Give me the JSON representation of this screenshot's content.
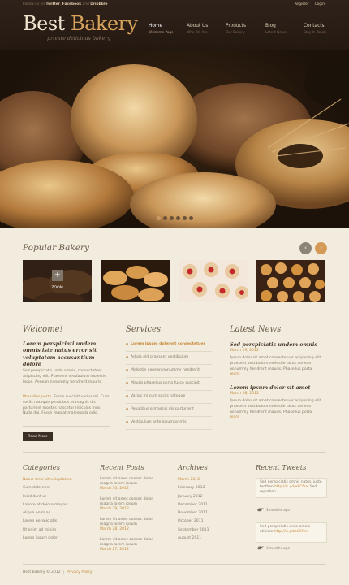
{
  "topbar": {
    "follow_prefix": "Follow us on",
    "twitter": "Twitter",
    "facebook": "Facebook",
    "and": "and",
    "dribbble": "Dribbble",
    "register": "Register",
    "login": "Login"
  },
  "logo": {
    "best": "Best",
    "bakery": "Bakery",
    "tagline": "private delicious bakery"
  },
  "nav": [
    {
      "label": "Home",
      "sub": "Welcome Page"
    },
    {
      "label": "About Us",
      "sub": "Who We Are"
    },
    {
      "label": "Products",
      "sub": "Our Bakery"
    },
    {
      "label": "Blog",
      "sub": "Latest News"
    },
    {
      "label": "Contacts",
      "sub": "Stay In Touch"
    }
  ],
  "colors": {
    "accent": "#c78a3c",
    "header_bg": "#2a1e15",
    "page_bg": "#f1ecde"
  },
  "popular": {
    "title": "Popular Bakery",
    "prev_icon": "‹",
    "next_icon": "›",
    "zoom_plus": "+",
    "zoom_label": "ZOOM"
  },
  "welcome": {
    "title": "Welcome!",
    "intro": "Lorem perspiciati undem omnis iste natus error sit voluptatem accusantium dolore",
    "body1": "Sed perspiciatis unde omnis, consectetuer adipiscing elit. Praesent vestibulum molestie lacus. Aenean nonummy hendrerit mauris.",
    "link": "Phasellus porta.",
    "body2": "Fusce suscipit varius mi. Cum sociis natoque penatibus et magnis dis parturient montes nascetur ridiculus mus. Nulla dui. Fusce feugiat malesuada odio.",
    "read_more": "Read More"
  },
  "services": {
    "title": "Services",
    "items": [
      "Lorem ipsum dolemet consectetuer",
      "Adipis elit praesent vestibulum",
      "Molestie aenean nonummy hendrerit",
      "Mauris phasellus porta fusce suscipit",
      "Varius mi cum sociis natoque",
      "Penatibus etmagnis dis parturient",
      "Vestibulum ante ipsum primis"
    ]
  },
  "news": {
    "title": "Latest News",
    "items": [
      {
        "title": "Sed perspiciatis undem omnis",
        "date": "March 29, 2012",
        "body": "Ipsum dolor sit amet consectetuer adipiscing elit praesent vestibulum molestie lacus aenean nonummy hendrerit mauris. Phasellus porta.",
        "more": "more"
      },
      {
        "title": "Lorem ipsum dolor sit amet",
        "date": "March 28, 2012",
        "body": "Ipsum dolor sit amet consectetuer adipiscing elit praesent vestibulum molestie lacus aenean nonummy hendrerit mauris. Phasellus porta.",
        "more": "more"
      }
    ]
  },
  "categories": {
    "title": "Categories",
    "items": [
      "Natus error sit voluptatem",
      "Cum doloremd",
      "Incididunt ut",
      "Labore et dolore magne",
      "Aliqua enim ac",
      "Lorem perspiciatis",
      "Ut enim ad minim",
      "Lorem ipsum dolor"
    ]
  },
  "recent_posts": {
    "title": "Recent Posts",
    "items": [
      {
        "text": "Lorem sit amet consec dolor magna lorem ipsum",
        "date": "March 30, 2012"
      },
      {
        "text": "Lorem sit amet consec dolor magna lorem ipsum",
        "date": "March 29, 2012"
      },
      {
        "text": "Lorem sit amet consec dolor magna lorem ipsum",
        "date": "March 28, 2012"
      },
      {
        "text": "Lorem sit amet consec dolor magna lorem ipsum",
        "date": "March 27, 2012"
      }
    ]
  },
  "archives": {
    "title": "Archives",
    "items": [
      "March 2012",
      "February 2012",
      "January 2012",
      "December 2011",
      "November 2011",
      "October 2011",
      "September 2011",
      "August 2011"
    ]
  },
  "tweets": {
    "title": "Recent Tweets",
    "items": [
      {
        "text": "Sed perspiciatis omnis natus, iusto tecthen",
        "link": "http://is.gd/e8Cfenl",
        "text2": "Sed reprehen",
        "ago": "3 months ago"
      },
      {
        "text": "Sed perspiciatis unde omnis otionan",
        "link": "http://is.gd/e8Cfenl",
        "text2": "",
        "ago": "3 months ago"
      }
    ]
  },
  "footer": {
    "copyright": "Best Bakery © 2012",
    "privacy": "Privacy Policy"
  }
}
